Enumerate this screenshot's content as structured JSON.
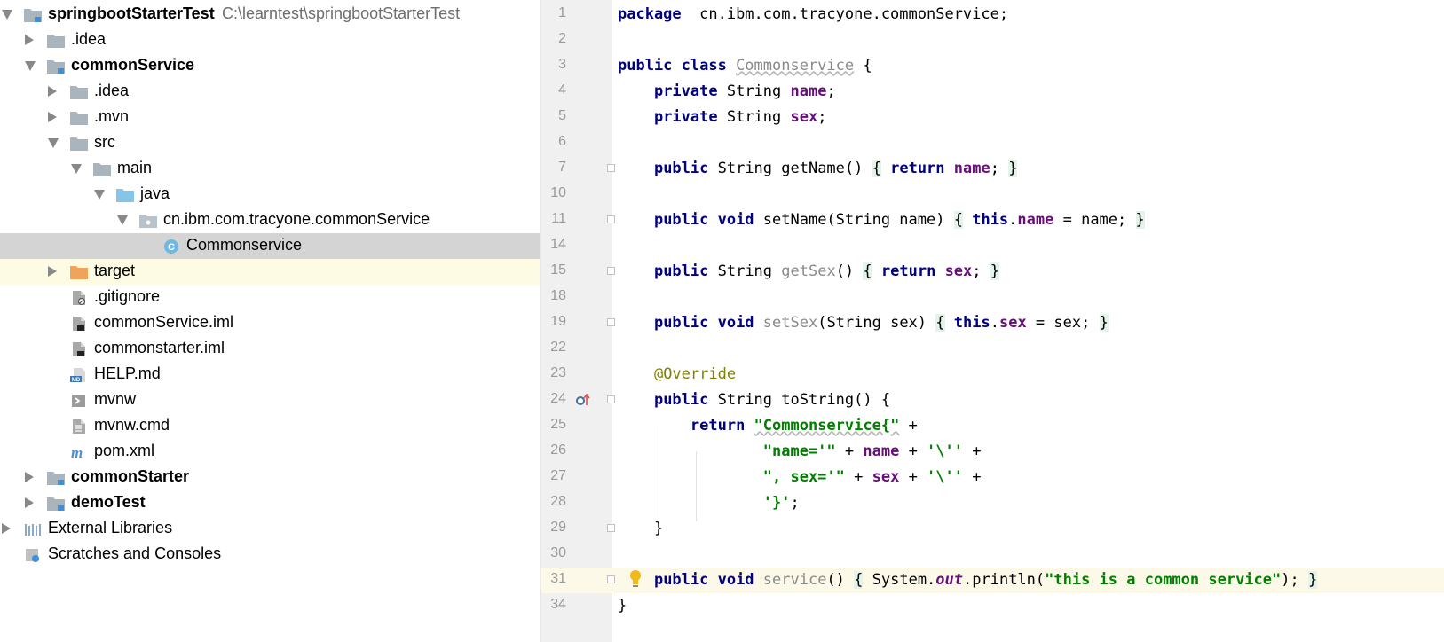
{
  "project_tree": {
    "items": [
      {
        "label": "springbootStarterTest",
        "path": "C:\\learntest\\springbootStarterTest",
        "level": 0,
        "arrow": "down",
        "icon": "module-folder-icon",
        "bold": true
      },
      {
        "label": ".idea",
        "level": 1,
        "arrow": "right",
        "icon": "folder-icon"
      },
      {
        "label": "commonService",
        "level": 1,
        "arrow": "down",
        "icon": "module-folder-icon",
        "bold": true
      },
      {
        "label": ".idea",
        "level": 2,
        "arrow": "right",
        "icon": "folder-icon"
      },
      {
        "label": ".mvn",
        "level": 2,
        "arrow": "right",
        "icon": "folder-icon"
      },
      {
        "label": "src",
        "level": 2,
        "arrow": "down",
        "icon": "folder-icon"
      },
      {
        "label": "main",
        "level": 3,
        "arrow": "down",
        "icon": "folder-icon"
      },
      {
        "label": "java",
        "level": 4,
        "arrow": "down",
        "icon": "source-folder-icon"
      },
      {
        "label": "cn.ibm.com.tracyone.commonService",
        "level": 5,
        "arrow": "down",
        "icon": "package-icon"
      },
      {
        "label": "Commonservice",
        "level": 6,
        "arrow": "none",
        "icon": "java-class-icon",
        "selected": true
      },
      {
        "label": "target",
        "level": 2,
        "arrow": "right",
        "icon": "excluded-folder-icon",
        "excluded": true
      },
      {
        "label": ".gitignore",
        "level": 2,
        "arrow": "none",
        "icon": "ignore-file-icon"
      },
      {
        "label": "commonService.iml",
        "level": 2,
        "arrow": "none",
        "icon": "iml-file-icon"
      },
      {
        "label": "commonstarter.iml",
        "level": 2,
        "arrow": "none",
        "icon": "iml-file-icon"
      },
      {
        "label": "HELP.md",
        "level": 2,
        "arrow": "none",
        "icon": "markdown-file-icon"
      },
      {
        "label": "mvnw",
        "level": 2,
        "arrow": "none",
        "icon": "shell-file-icon"
      },
      {
        "label": "mvnw.cmd",
        "level": 2,
        "arrow": "none",
        "icon": "text-file-icon"
      },
      {
        "label": "pom.xml",
        "level": 2,
        "arrow": "none",
        "icon": "maven-icon"
      },
      {
        "label": "commonStarter",
        "level": 1,
        "arrow": "right",
        "icon": "module-folder-icon",
        "bold": true
      },
      {
        "label": "demoTest",
        "level": 1,
        "arrow": "right",
        "icon": "module-folder-icon",
        "bold": true
      },
      {
        "label": "External Libraries",
        "level": 0,
        "arrow": "right",
        "icon": "libraries-icon"
      },
      {
        "label": "Scratches and Consoles",
        "level": 0,
        "arrow": "none",
        "icon": "scratches-icon"
      }
    ]
  },
  "editor": {
    "lines": [
      {
        "num": "1",
        "segs": [
          [
            "kw",
            "package"
          ],
          [
            "",
            "  cn.ibm.com.tracyone.commonService;"
          ]
        ]
      },
      {
        "num": "2",
        "segs": []
      },
      {
        "num": "3",
        "segs": [
          [
            "kw",
            "public class "
          ],
          [
            "unused wavy",
            "Commonservice"
          ],
          [
            "",
            " {"
          ]
        ]
      },
      {
        "num": "4",
        "segs": [
          [
            "",
            "    "
          ],
          [
            "kw",
            "private "
          ],
          [
            "",
            "String "
          ],
          [
            "fld",
            "name"
          ],
          [
            "",
            ";"
          ]
        ]
      },
      {
        "num": "5",
        "segs": [
          [
            "",
            "    "
          ],
          [
            "kw",
            "private "
          ],
          [
            "",
            "String "
          ],
          [
            "fld",
            "sex"
          ],
          [
            "",
            ";"
          ]
        ]
      },
      {
        "num": "6",
        "segs": []
      },
      {
        "num": "7",
        "fold": "open",
        "segs": [
          [
            "",
            "    "
          ],
          [
            "kw",
            "public "
          ],
          [
            "",
            "String getName() "
          ],
          [
            "fold",
            "{"
          ],
          [
            "",
            " "
          ],
          [
            "kw",
            "return "
          ],
          [
            "fld",
            "name"
          ],
          [
            "",
            "; "
          ],
          [
            "fold",
            "}"
          ]
        ]
      },
      {
        "num": "10",
        "segs": []
      },
      {
        "num": "11",
        "fold": "open",
        "segs": [
          [
            "",
            "    "
          ],
          [
            "kw",
            "public void "
          ],
          [
            "",
            "setName(String name) "
          ],
          [
            "fold",
            "{"
          ],
          [
            "",
            " "
          ],
          [
            "kw",
            "this"
          ],
          [
            "",
            "."
          ],
          [
            "fld",
            "name"
          ],
          [
            "",
            " = name; "
          ],
          [
            "fold",
            "}"
          ]
        ]
      },
      {
        "num": "14",
        "segs": []
      },
      {
        "num": "15",
        "fold": "open",
        "segs": [
          [
            "",
            "    "
          ],
          [
            "kw",
            "public "
          ],
          [
            "",
            "String "
          ],
          [
            "unused",
            "getSex"
          ],
          [
            "",
            "() "
          ],
          [
            "fold",
            "{"
          ],
          [
            "",
            " "
          ],
          [
            "kw",
            "return "
          ],
          [
            "fld",
            "sex"
          ],
          [
            "",
            "; "
          ],
          [
            "fold",
            "}"
          ]
        ]
      },
      {
        "num": "18",
        "segs": []
      },
      {
        "num": "19",
        "fold": "open",
        "segs": [
          [
            "",
            "    "
          ],
          [
            "kw",
            "public void "
          ],
          [
            "unused",
            "setSex"
          ],
          [
            "",
            "(String sex) "
          ],
          [
            "fold",
            "{"
          ],
          [
            "",
            " "
          ],
          [
            "kw",
            "this"
          ],
          [
            "",
            "."
          ],
          [
            "fld",
            "sex"
          ],
          [
            "",
            " = sex; "
          ],
          [
            "fold",
            "}"
          ]
        ]
      },
      {
        "num": "22",
        "segs": []
      },
      {
        "num": "23",
        "segs": [
          [
            "",
            "    "
          ],
          [
            "ann",
            "@Override"
          ]
        ]
      },
      {
        "num": "24",
        "fold": "start",
        "override": true,
        "segs": [
          [
            "",
            "    "
          ],
          [
            "kw",
            "public "
          ],
          [
            "",
            "String toString() {"
          ]
        ]
      },
      {
        "num": "25",
        "segs": [
          [
            "",
            "        "
          ],
          [
            "kw",
            "return "
          ],
          [
            "str wavy",
            "\"Commonservice{\""
          ],
          [
            "",
            " +"
          ]
        ]
      },
      {
        "num": "26",
        "segs": [
          [
            "",
            "                "
          ],
          [
            "str",
            "\"name='\""
          ],
          [
            "",
            " + "
          ],
          [
            "fld",
            "name"
          ],
          [
            "",
            " + "
          ],
          [
            "str",
            "'\\''"
          ],
          [
            "",
            " +"
          ]
        ]
      },
      {
        "num": "27",
        "segs": [
          [
            "",
            "                "
          ],
          [
            "str",
            "\", sex='\""
          ],
          [
            "",
            " + "
          ],
          [
            "fld",
            "sex"
          ],
          [
            "",
            " + "
          ],
          [
            "str",
            "'\\''"
          ],
          [
            "",
            " +"
          ]
        ]
      },
      {
        "num": "28",
        "segs": [
          [
            "",
            "                "
          ],
          [
            "str",
            "'}'"
          ],
          [
            "",
            ";"
          ]
        ]
      },
      {
        "num": "29",
        "fold": "end",
        "segs": [
          [
            "",
            "    }"
          ]
        ]
      },
      {
        "num": "30",
        "segs": []
      },
      {
        "num": "31",
        "fold": "open",
        "current": true,
        "bulb": true,
        "segs": [
          [
            "",
            "    "
          ],
          [
            "kw",
            "public void "
          ],
          [
            "unused",
            "service"
          ],
          [
            "",
            "() "
          ],
          [
            "fold",
            "{"
          ],
          [
            "",
            " System."
          ],
          [
            "stat",
            "out"
          ],
          [
            "",
            ".println("
          ],
          [
            "str",
            "\"this is a common service\""
          ],
          [
            "",
            "); "
          ],
          [
            "fold",
            "}"
          ]
        ]
      },
      {
        "num": "34",
        "segs": [
          [
            "",
            "}"
          ]
        ]
      }
    ]
  },
  "colors": {
    "keyword": "#000080",
    "field": "#660e7a",
    "string": "#008000",
    "annotation": "#808000",
    "selected_row": "#d4d4d4",
    "excluded_row": "#fdfbe3",
    "current_line": "#fcf9e8",
    "gutter": "#f0f0f0"
  }
}
